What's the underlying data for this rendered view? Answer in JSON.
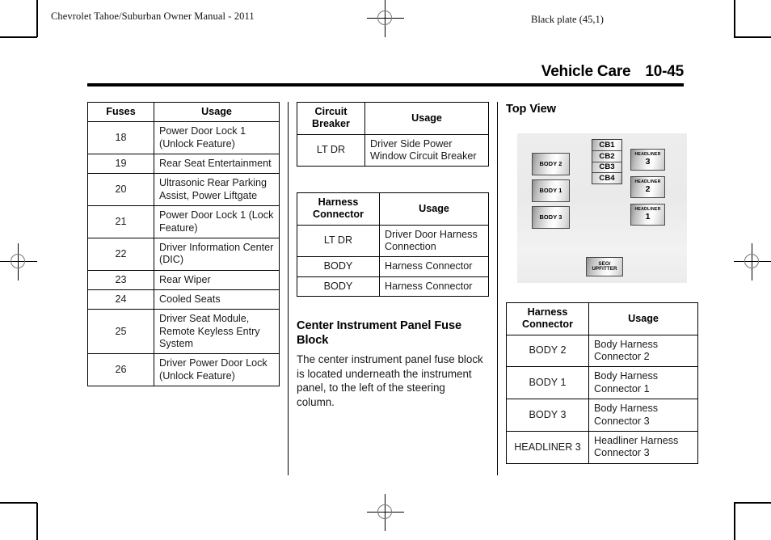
{
  "page": {
    "header_left": "Chevrolet Tahoe/Suburban Owner Manual - 2011",
    "header_right": "Black plate (45,1)",
    "running_head_title": "Vehicle Care",
    "running_head_page": "10-45"
  },
  "fuse_table": {
    "headers": [
      "Fuses",
      "Usage"
    ],
    "rows": [
      {
        "fuse": "18",
        "usage": "Power Door Lock 1 (Unlock Feature)"
      },
      {
        "fuse": "19",
        "usage": "Rear Seat Entertainment"
      },
      {
        "fuse": "20",
        "usage": "Ultrasonic Rear Parking Assist, Power Liftgate"
      },
      {
        "fuse": "21",
        "usage": "Power Door Lock 1 (Lock Feature)"
      },
      {
        "fuse": "22",
        "usage": "Driver Information Center (DIC)"
      },
      {
        "fuse": "23",
        "usage": "Rear Wiper"
      },
      {
        "fuse": "24",
        "usage": "Cooled Seats"
      },
      {
        "fuse": "25",
        "usage": "Driver Seat Module, Remote Keyless Entry System"
      },
      {
        "fuse": "26",
        "usage": "Driver Power Door Lock (Unlock Feature)"
      }
    ]
  },
  "circuit_breaker_table": {
    "headers": [
      "Circuit Breaker",
      "Usage"
    ],
    "rows": [
      {
        "breaker": "LT DR",
        "usage": "Driver Side Power Window Circuit Breaker"
      }
    ]
  },
  "harness_table_mid": {
    "headers": [
      "Harness Connector",
      "Usage"
    ],
    "rows": [
      {
        "connector": "LT DR",
        "usage": "Driver Door Harness Connection"
      },
      {
        "connector": "BODY",
        "usage": "Harness Connector"
      },
      {
        "connector": "BODY",
        "usage": "Harness Connector"
      }
    ]
  },
  "center_section": {
    "heading": "Center Instrument Panel Fuse Block",
    "body": "The center instrument panel fuse block is located underneath the instrument panel, to the left of the steering column."
  },
  "top_view": {
    "heading": "Top View",
    "boxes": [
      {
        "id": "body-2",
        "label": "BODY 2"
      },
      {
        "id": "body-1",
        "label": "BODY 1"
      },
      {
        "id": "body-3",
        "label": "BODY 3"
      },
      {
        "id": "cb1",
        "label": "CB1"
      },
      {
        "id": "cb2",
        "label": "CB2"
      },
      {
        "id": "cb3",
        "label": "CB3"
      },
      {
        "id": "cb4",
        "label": "CB4"
      },
      {
        "id": "headliner-3",
        "label_top": "HEADLINER",
        "label_num": "3"
      },
      {
        "id": "headliner-2",
        "label_top": "HEADLINER",
        "label_num": "2"
      },
      {
        "id": "headliner-1",
        "label_top": "HEADLINER",
        "label_num": "1"
      },
      {
        "id": "seo-upfitter",
        "label_top": "SEO/",
        "label_bottom": "UPFITTER"
      }
    ]
  },
  "harness_table_right": {
    "headers": [
      "Harness Connector",
      "Usage"
    ],
    "rows": [
      {
        "connector": "BODY 2",
        "usage": "Body Harness Connector 2"
      },
      {
        "connector": "BODY 1",
        "usage": "Body Harness Connector 1"
      },
      {
        "connector": "BODY 3",
        "usage": "Body Harness Connector 3"
      },
      {
        "connector": "HEADLINER 3",
        "usage": "Headliner Harness Connector 3"
      }
    ]
  },
  "colors": {
    "ink": "#000000",
    "rule": "#000000",
    "diagram_background": "#ececec"
  }
}
